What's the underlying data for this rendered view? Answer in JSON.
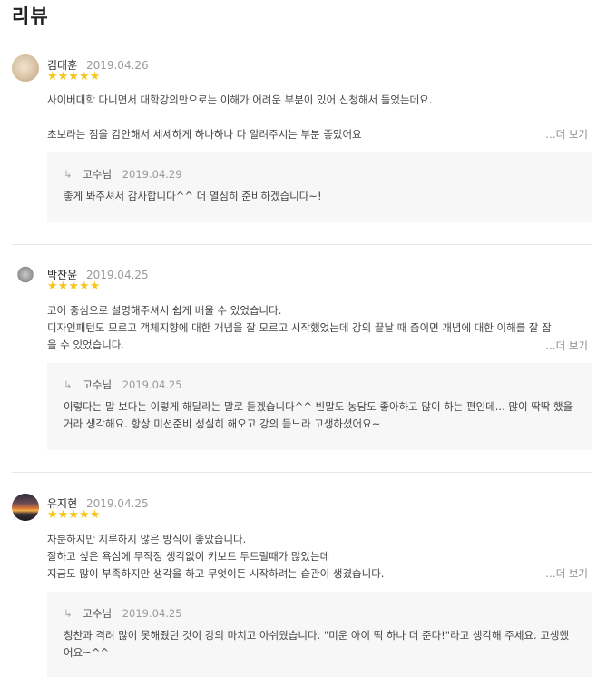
{
  "title": "리뷰",
  "more_label": "…더 보기",
  "star_color": "#f5c518",
  "reviews": [
    {
      "author": "김태훈",
      "date": "2019.04.26",
      "rating": 5,
      "stars": "★★★★★",
      "lines": [
        "사이버대학 다니면서 대학강의만으로는 이해가 어려운 부분이 있어 신청해서 들었는데요.",
        "",
        "초보라는 점을 감안해서 세세하게 하나하나 다 알려주시는 부분 좋았어요"
      ],
      "reply": {
        "author": "고수님",
        "date": "2019.04.29",
        "text": "좋게 봐주셔서 감사합니다^^ 더 열심히 준비하겠습니다~!"
      }
    },
    {
      "author": "박찬윤",
      "date": "2019.04.25",
      "rating": 5,
      "stars": "★★★★★",
      "lines": [
        "코어 중심으로 설명해주셔서 쉽게 배울 수 있었습니다.",
        "디자인패턴도 모르고 객체지향에 대한 개념을 잘 모르고 시작했었는데 강의 끝날 때 즘이면 개념에 대한 이해를 잘 잡을 수 있었습니다."
      ],
      "reply": {
        "author": "고수님",
        "date": "2019.04.25",
        "text": "이렇다는 말 보다는 이렇게 해달라는 말로 듣겠습니다^^ 빈말도 농담도 좋아하고 많이 하는 편인데... 많이 딱딱 했을거라 생각해요. 항상 미션준비 성실히 해오고 강의 듣느라 고생하셨어요~"
      }
    },
    {
      "author": "유지현",
      "date": "2019.04.25",
      "rating": 5,
      "stars": "★★★★★",
      "lines": [
        "차분하지만 지루하지 않은 방식이 좋았습니다.",
        "잘하고 싶은 욕심에 무작정 생각없이 키보드 두드릴때가 많았는데",
        "지금도 많이 부족하지만 생각을 하고 무엇이든 시작하려는 습관이 생겼습니다."
      ],
      "reply": {
        "author": "고수님",
        "date": "2019.04.25",
        "text": "칭찬과 격려 많이 못해줬던 것이 강의 마치고 아쉬웠습니다. \"미운 아이 떡 하나 더 준다!\"라고 생각해 주세요. 고생했어요~^^"
      }
    }
  ]
}
